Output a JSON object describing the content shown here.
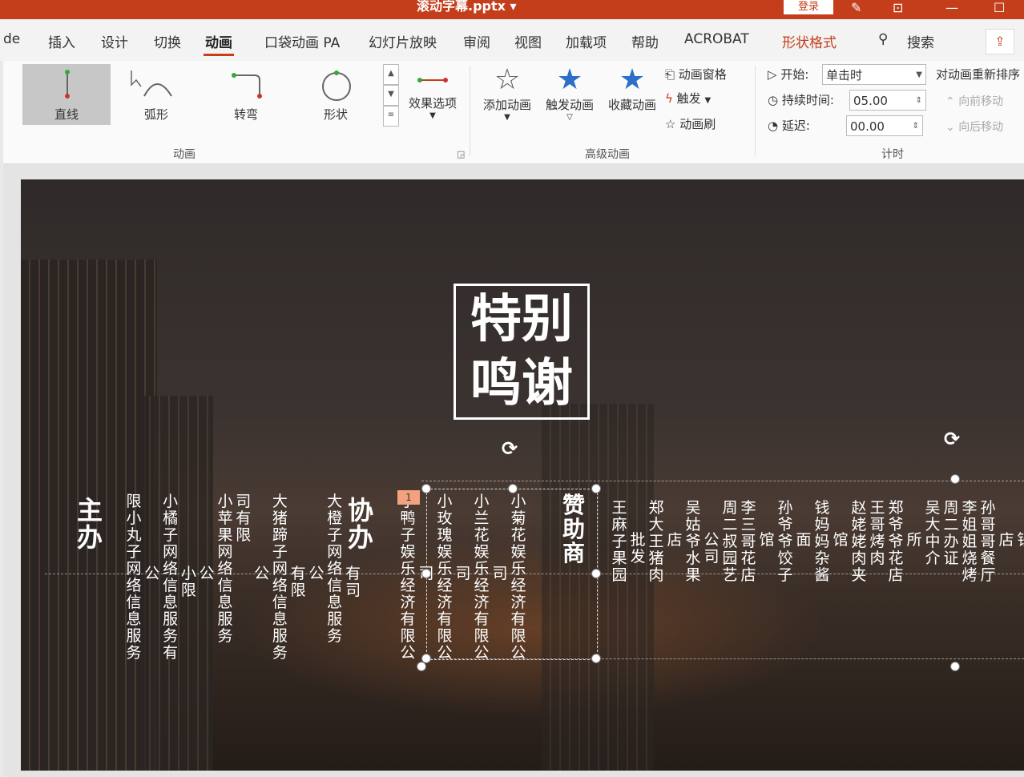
{
  "window": {
    "title": "滚动字幕.pptx ▾",
    "login_label": "登录"
  },
  "menu": {
    "tabs": [
      "de",
      "插入",
      "设计",
      "切换",
      "动画",
      "口袋动画 PA",
      "幻灯片放映",
      "审阅",
      "视图",
      "加载项",
      "帮助",
      "ACROBAT",
      "形状格式"
    ],
    "search_label": "搜索"
  },
  "ribbon": {
    "gallery": [
      {
        "label": "直线",
        "selected": true
      },
      {
        "label": "弧形"
      },
      {
        "label": "转弯"
      },
      {
        "label": "形状"
      }
    ],
    "effect_options": "效果选项",
    "add_animation": "添加动画",
    "trigger_animation": "触发动画",
    "favorite_animation": "收藏动画",
    "animation_pane": "动画窗格",
    "trigger": "触发",
    "animation_painter": "动画刷",
    "groups": {
      "animation": "动画",
      "advanced": "高级动画",
      "timing": "计时"
    },
    "timing": {
      "start_label": "开始:",
      "start_value": "单击时",
      "duration_label": "持续时间:",
      "duration_value": "05.00",
      "delay_label": "延迟:",
      "delay_value": "00.00",
      "reorder_title": "对动画重新排序",
      "move_earlier": "向前移动",
      "move_later": "向后移动"
    }
  },
  "slide": {
    "title_line1": "特别",
    "title_line2": "鸣谢",
    "sections": {
      "host": "主办",
      "co_host": "协办",
      "sponsor": "赞助商"
    },
    "badge": "1",
    "host_columns": [
      "限小丸子网络信息服务",
      "公",
      "小橘子网络信息服务有",
      "小限",
      "公",
      "小苹果网络信息服务",
      "司有限",
      "公",
      "大猪蹄子网络信息服务",
      "有限",
      "公",
      "大橙子网络信息服务",
      "有司"
    ],
    "co_columns": [
      "小鸭子娱乐经济有限公",
      "司",
      "小玫瑰娱乐经济有限公",
      "司",
      "小兰花娱乐经济有限公",
      "司",
      "小菊花娱乐经济有限公"
    ],
    "sponsor_columns": [
      "王麻子果园",
      "批发",
      "郑大王猪肉",
      "店",
      "吴姑爷水果",
      "公司",
      "周二叔园艺",
      "李三哥花店",
      "馆",
      "孙爷爷饺子",
      "面",
      "钱妈妈杂酱",
      "馆",
      "赵姥姥肉夹",
      "王哥烤肉",
      "郑爷爷花店",
      "所",
      "吴大中介",
      "周二办证",
      "李姐姐烧烤",
      "孙哥哥餐厅",
      "店",
      "钱"
    ]
  }
}
